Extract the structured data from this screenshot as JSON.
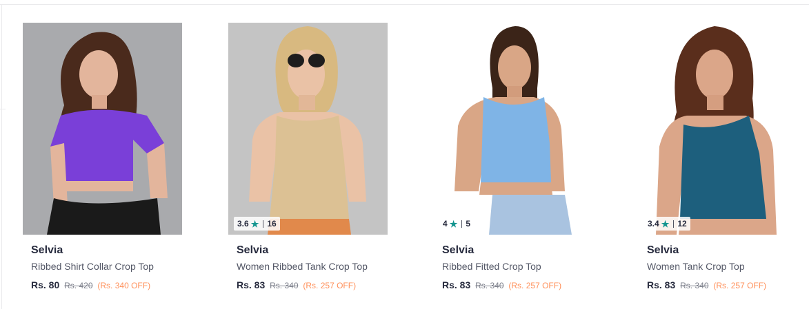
{
  "products": [
    {
      "brand": "Selvia",
      "name": "Ribbed Shirt Collar Crop Top",
      "price": "Rs. 80",
      "mrp": "Rs. 420",
      "discount": "(Rs. 340 OFF)",
      "rating": null,
      "rating_count": null,
      "top_color": "#7a3fd8",
      "bg_color": "#a9aaad"
    },
    {
      "brand": "Selvia",
      "name": "Women Ribbed Tank Crop Top",
      "price": "Rs. 83",
      "mrp": "Rs. 340",
      "discount": "(Rs. 257 OFF)",
      "rating": "3.6",
      "rating_count": "16",
      "top_color": "#dcc194",
      "bg_color": "#c9c9c9"
    },
    {
      "brand": "Selvia",
      "name": "Ribbed Fitted Crop Top",
      "price": "Rs. 83",
      "mrp": "Rs. 340",
      "discount": "(Rs. 257 OFF)",
      "rating": "4",
      "rating_count": "5",
      "top_color": "#7fb4e6",
      "bg_color": "#ffffff"
    },
    {
      "brand": "Selvia",
      "name": "Women Tank Crop Top",
      "price": "Rs. 83",
      "mrp": "Rs. 340",
      "discount": "(Rs. 257 OFF)",
      "rating": "3.4",
      "rating_count": "12",
      "top_color": "#1d5f7d",
      "bg_color": "#ffffff"
    }
  ],
  "icons": {
    "rating_star": "star-icon"
  },
  "colors": {
    "rating_star": "#14958f",
    "discount": "#ff905a"
  }
}
